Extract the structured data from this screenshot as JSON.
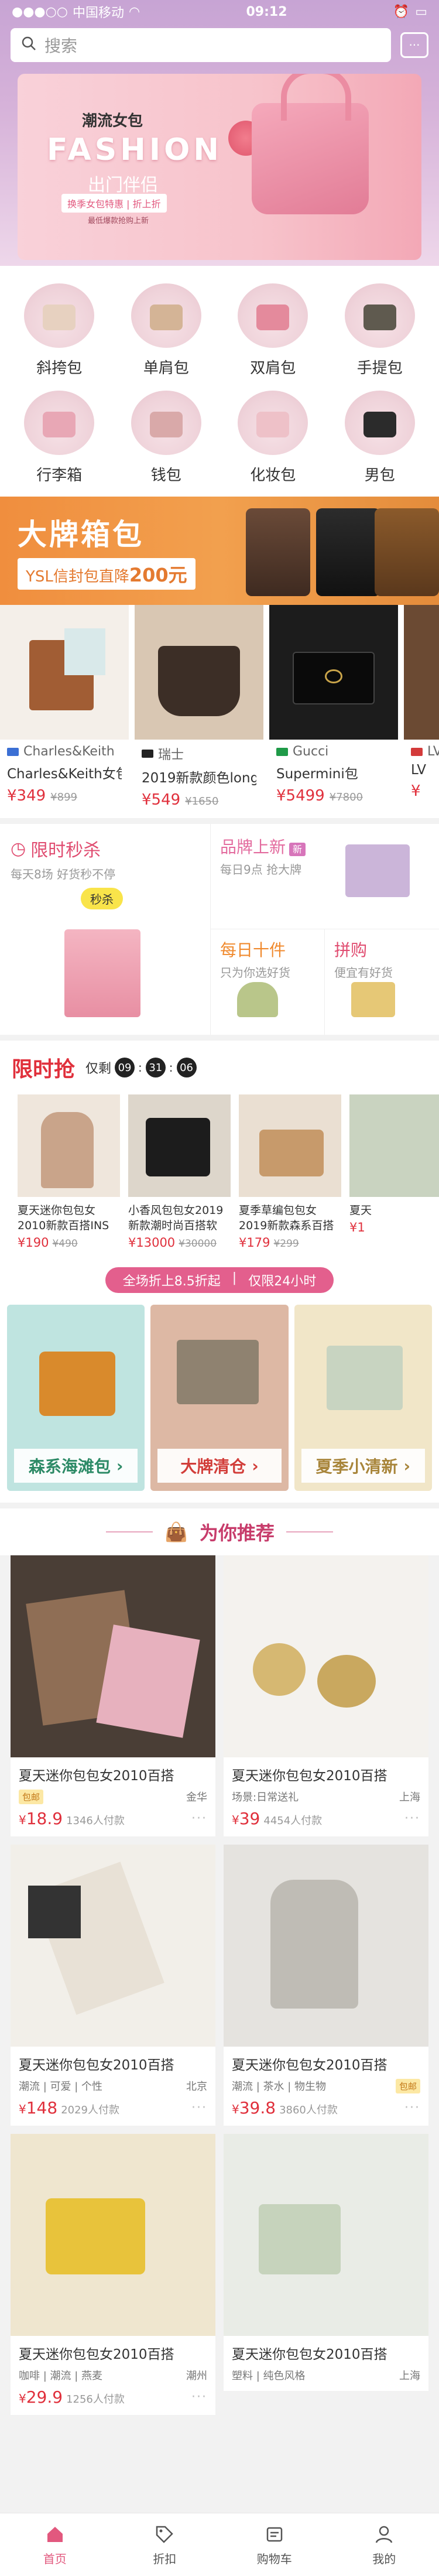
{
  "status": {
    "carrier": "中国移动",
    "time": "09:12"
  },
  "search": {
    "placeholder": "搜索"
  },
  "banner": {
    "title": "潮流女包",
    "headline": "FASHION",
    "sub": "出门伴侣",
    "desc": "换季女包特惠 | 折上折",
    "fine": "最低爆款抢购上新"
  },
  "categories": [
    {
      "label": "斜挎包"
    },
    {
      "label": "单肩包"
    },
    {
      "label": "双肩包"
    },
    {
      "label": "手提包"
    },
    {
      "label": "行李箱"
    },
    {
      "label": "钱包"
    },
    {
      "label": "化妆包"
    },
    {
      "label": "男包"
    }
  ],
  "brand_banner": {
    "title": "大牌箱包",
    "promo_prefix": "YSL信封包直降",
    "promo_amount": "200元"
  },
  "brands": [
    {
      "name": "Charles&Keith",
      "title": "Charles&Keith女包",
      "price": "¥349",
      "old": "¥899",
      "flag": "#3b6fd4"
    },
    {
      "name": "瑞士",
      "title": "2019新款颜色long",
      "price": "¥549",
      "old": "¥1650",
      "flag": "#222222"
    },
    {
      "name": "Gucci",
      "title": "Supermini包",
      "price": "¥5499",
      "old": "¥7800",
      "flag": "#1f9a48"
    },
    {
      "name": "LV",
      "title": "LV",
      "price": "¥",
      "old": "",
      "flag": "#d33a3a"
    }
  ],
  "promo": {
    "flash_title": "限时秒杀",
    "flash_desc": "每天8场 好货秒不停",
    "flash_tag": "秒杀",
    "new_title": "品牌上新",
    "new_badge": "新",
    "new_desc": "每日9点 抢大牌",
    "daily_title": "每日十件",
    "daily_desc": "只为你选好货",
    "group_title": "拼购",
    "group_desc": "便宜有好货"
  },
  "limited": {
    "title": "限时抢",
    "remain": "仅剩",
    "h": "09",
    "m": "31",
    "s": "06",
    "items": [
      {
        "title": "夏天迷你包包女2010新款百搭INS",
        "price": "¥190",
        "old": "¥490"
      },
      {
        "title": "小香风包包女2019新款潮时尚百搭软",
        "price": "¥13000",
        "old": "¥30000"
      },
      {
        "title": "夏季草编包包女2019新款森系百搭",
        "price": "¥179",
        "old": "¥299"
      },
      {
        "title": "夏天",
        "price": "¥1",
        "old": ""
      }
    ]
  },
  "discount": {
    "left": "全场折上8.5折起",
    "right": "仅限24小时"
  },
  "themes": [
    {
      "label": "森系海滩包",
      "color": "#2c8a66"
    },
    {
      "label": "大牌清仓",
      "color": "#d23e3a"
    },
    {
      "label": "夏季小清新",
      "color": "#a8853a"
    }
  ],
  "recommend": {
    "title": "为你推荐",
    "left": [
      {
        "title": "夏天迷你包包女2010百搭",
        "tag": "包邮",
        "loc": "金华",
        "tags": "",
        "price": "18.9",
        "paid": "1346人付款"
      },
      {
        "title": "夏天迷你包包女2010百搭",
        "tag": "",
        "loc": "北京",
        "tags": "潮流 | 可爱 | 个性",
        "price": "148",
        "paid": "2029人付款"
      },
      {
        "title": "夏天迷你包包女2010百搭",
        "tag": "",
        "loc": "潮州",
        "tags": "咖啡 | 潮流 | 燕麦",
        "price": "29.9",
        "paid": "1256人付款"
      }
    ],
    "right": [
      {
        "title": "夏天迷你包包女2010百搭",
        "tag": "",
        "loc": "上海",
        "tags": "场景:日常送礼",
        "price": "39",
        "paid": "4454人付款"
      },
      {
        "title": "夏天迷你包包女2010百搭",
        "tag": "包邮",
        "loc": "上海",
        "tags": "潮流 | 茶水 | 物生物",
        "price": "39.8",
        "paid": "3860人付款"
      },
      {
        "title": "夏天迷你包包女2010百搭",
        "tag": "",
        "loc": "上海",
        "tags": "塑料 | 纯色风格",
        "price": "",
        "paid": ""
      }
    ]
  },
  "tabbar": [
    {
      "label": "首页"
    },
    {
      "label": "折扣"
    },
    {
      "label": "购物车"
    },
    {
      "label": "我的"
    }
  ],
  "colors": {
    "accent": "#e2587e",
    "price": "#e0303c",
    "brand_orange": "#f08e3e"
  }
}
